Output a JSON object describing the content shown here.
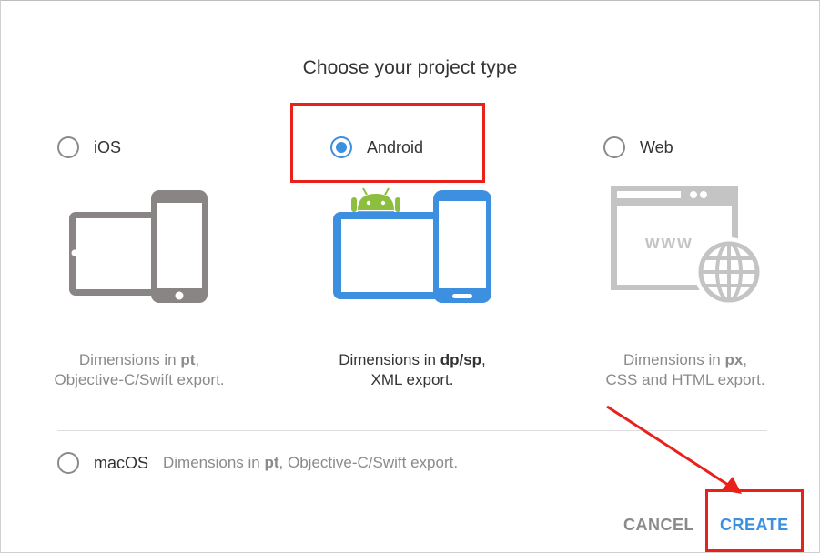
{
  "dialog": {
    "title": "Choose your project type"
  },
  "options": {
    "ios": {
      "label": "iOS",
      "selected": false,
      "icon": "ios-devices-icon",
      "desc_prefix": "Dimensions in ",
      "desc_unit": "pt",
      "desc_suffix": ",",
      "desc_line2": "Objective-C/Swift export."
    },
    "android": {
      "label": "Android",
      "selected": true,
      "icon": "android-devices-icon",
      "desc_prefix": "Dimensions in ",
      "desc_unit": "dp/sp",
      "desc_suffix": ",",
      "desc_line2": "XML export."
    },
    "web": {
      "label": "Web",
      "selected": false,
      "icon": "web-browser-globe-icon",
      "browser_text": "www",
      "desc_prefix": "Dimensions in ",
      "desc_unit": "px",
      "desc_suffix": ",",
      "desc_line2": "CSS and HTML export."
    },
    "macos": {
      "label": "macOS",
      "selected": false,
      "desc_prefix": "Dimensions in ",
      "desc_unit": "pt",
      "desc_suffix": ", Objective-C/Swift export."
    }
  },
  "buttons": {
    "cancel": "CANCEL",
    "create": "CREATE"
  },
  "colors": {
    "accent": "#3d8fe0",
    "muted_icon": "#8a8585",
    "web_icon": "#c4c4c4",
    "android_green": "#8cbf3f",
    "annotation": "#e8221b"
  }
}
